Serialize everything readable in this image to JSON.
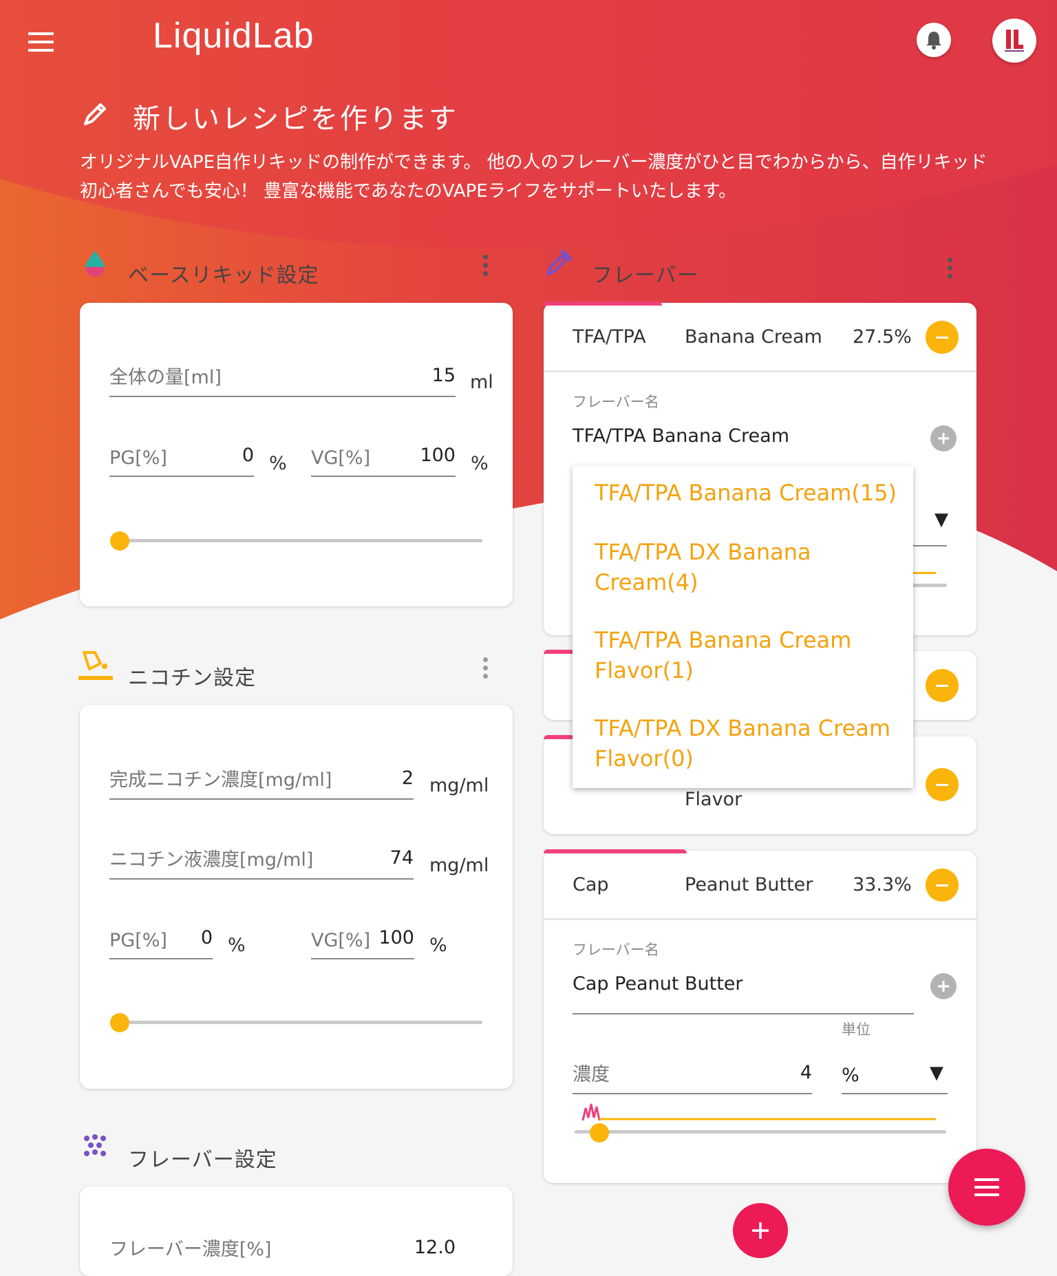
{
  "header": {
    "logo": "LiquidLab"
  },
  "page": {
    "title": "新しいレシピを作ります",
    "description": "オリジナルVAPE自作リキッドの制作ができます。 他の人のフレーバー濃度がひと目でわからから、自作リキッド初心者さんでも安心！ 豊富な機能であなたのVAPEライフをサポートいたします。"
  },
  "base": {
    "title": "ベースリキッド設定",
    "total_label": "全体の量[ml]",
    "total_value": "15",
    "total_unit": "ml",
    "pg_label": "PG[%]",
    "pg_value": "0",
    "pg_unit": "%",
    "vg_label": "VG[%]",
    "vg_value": "100",
    "vg_unit": "%",
    "slider_fraction": 0
  },
  "nicotine": {
    "title": "ニコチン設定",
    "target_label": "完成ニコチン濃度[mg/ml]",
    "target_value": "2",
    "target_unit": "mg/ml",
    "liquid_label": "ニコチン液濃度[mg/ml]",
    "liquid_value": "74",
    "liquid_unit": "mg/ml",
    "pg_label": "PG[%]",
    "pg_value": "0",
    "pg_unit": "%",
    "vg_label": "VG[%]",
    "vg_value": "100",
    "vg_unit": "%",
    "slider_fraction": 0
  },
  "flavor_settings": {
    "title": "フレーバー設定",
    "concentration_label": "フレーバー濃度[%]",
    "concentration_value": "12.0"
  },
  "flavors": {
    "title": "フレーバー",
    "name_field_label": "フレーバー名",
    "items": [
      {
        "brand": "TFA/TPA",
        "name": "Banana Cream",
        "percent": "27.5%",
        "full_name": "TFA/TPA Banana Cream"
      },
      {
        "name_partial": "Flavor"
      },
      {
        "brand": "Cap",
        "name": "Peanut Butter",
        "percent": "33.3%",
        "full_name": "Cap Peanut Butter",
        "conc_label": "濃度",
        "conc_value": "4",
        "unit_label": "単位",
        "unit_value": "%"
      }
    ],
    "dropdown": [
      "TFA/TPA Banana Cream(15)",
      "TFA/TPA DX Banana Cream(4)",
      "TFA/TPA Banana Cream Flavor(1)",
      "TFA/TPA DX Banana Cream Flavor(0)"
    ]
  },
  "colors": {
    "accent": "#fbb40b",
    "primary": "#ec1a55",
    "tab": "#f0407a"
  }
}
